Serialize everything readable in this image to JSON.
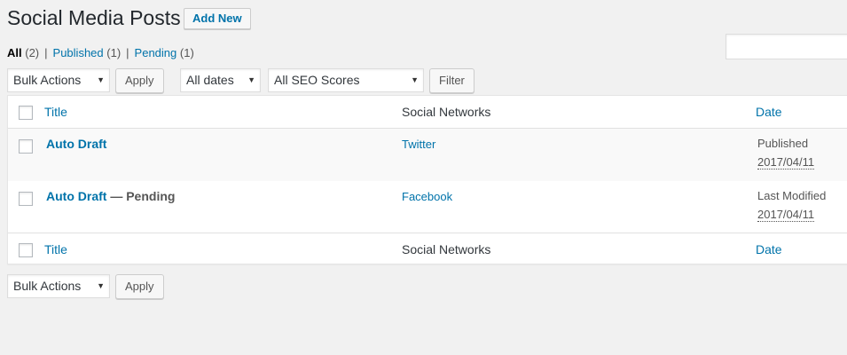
{
  "header": {
    "title": "Social Media Posts",
    "add_new_label": "Add New"
  },
  "views": [
    {
      "label": "All",
      "count": "(2)"
    },
    {
      "label": "Published",
      "count": "(1)"
    },
    {
      "label": "Pending",
      "count": "(1)"
    }
  ],
  "search": {
    "value": ""
  },
  "tablenav_top": {
    "bulk_actions": "Bulk Actions",
    "apply_label": "Apply",
    "dates_filter": "All dates",
    "seo_filter": "All SEO Scores",
    "filter_label": "Filter"
  },
  "table": {
    "columns": {
      "title": "Title",
      "networks": "Social Networks",
      "date": "Date"
    },
    "rows": [
      {
        "title": "Auto Draft",
        "state": "",
        "network": "Twitter",
        "date_status": "Published",
        "date": "2017/04/11"
      },
      {
        "title": "Auto Draft",
        "state": " — Pending",
        "network": "Facebook",
        "date_status": "Last Modified",
        "date": "2017/04/11"
      }
    ]
  },
  "tablenav_bottom": {
    "bulk_actions": "Bulk Actions",
    "apply_label": "Apply"
  },
  "colors": {
    "link": "#0073aa",
    "background": "#f1f1f1"
  }
}
